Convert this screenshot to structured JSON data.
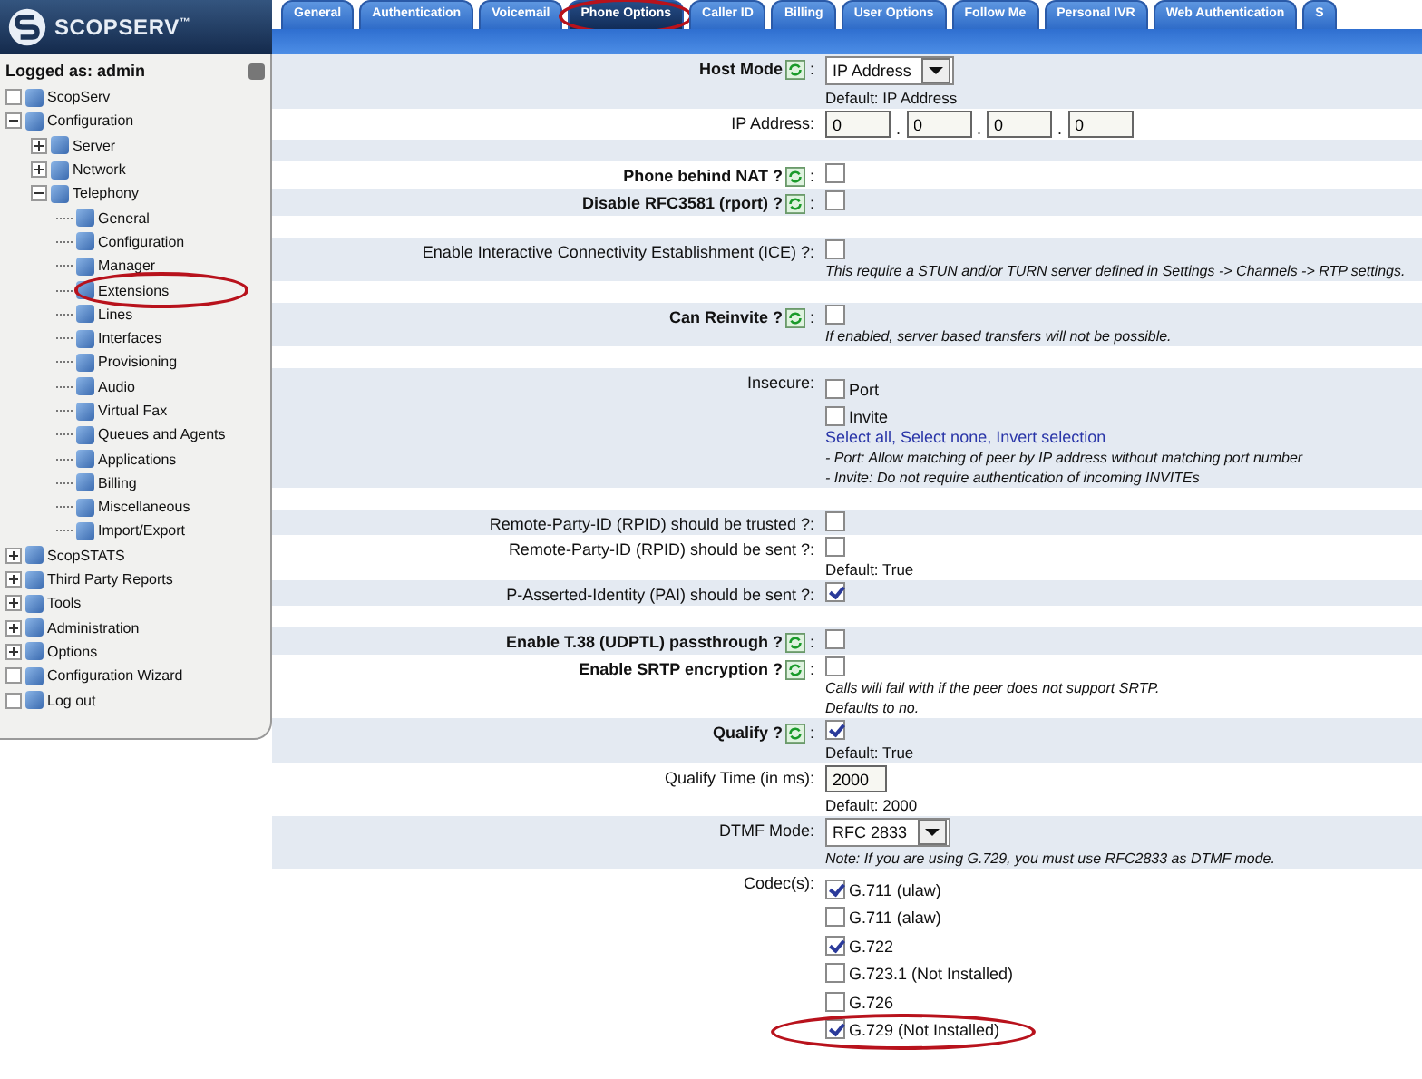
{
  "logo": {
    "name": "SCOPSERV",
    "mark": "™"
  },
  "tabs": [
    {
      "label": "General",
      "selected": false
    },
    {
      "label": "Authentication",
      "selected": false
    },
    {
      "label": "Voicemail",
      "selected": false
    },
    {
      "label": "Phone Options",
      "selected": true,
      "circled": true
    },
    {
      "label": "Caller ID",
      "selected": false
    },
    {
      "label": "Billing",
      "selected": false
    },
    {
      "label": "User Options",
      "selected": false
    },
    {
      "label": "Follow Me",
      "selected": false
    },
    {
      "label": "Personal IVR",
      "selected": false
    },
    {
      "label": "Web Authentication",
      "selected": false
    },
    {
      "label": "S",
      "selected": false
    }
  ],
  "sidebar": {
    "user": "Logged as: admin",
    "items": [
      {
        "label": "ScopServ"
      },
      {
        "label": "Configuration",
        "expanded": true,
        "children": [
          {
            "label": "Server",
            "expanded": false
          },
          {
            "label": "Network",
            "expanded": false
          },
          {
            "label": "Telephony",
            "expanded": true,
            "children": [
              {
                "label": "General"
              },
              {
                "label": "Configuration"
              },
              {
                "label": "Manager"
              },
              {
                "label": "Extensions",
                "circled": true
              },
              {
                "label": "Lines"
              },
              {
                "label": "Interfaces"
              },
              {
                "label": "Provisioning"
              },
              {
                "label": "Audio"
              },
              {
                "label": "Virtual Fax"
              },
              {
                "label": "Queues and Agents"
              },
              {
                "label": "Applications"
              },
              {
                "label": "Billing"
              },
              {
                "label": "Miscellaneous"
              },
              {
                "label": "Import/Export"
              }
            ]
          }
        ]
      },
      {
        "label": "ScopSTATS",
        "expanded": false
      },
      {
        "label": "Third Party Reports",
        "expanded": false
      },
      {
        "label": "Tools",
        "expanded": false
      },
      {
        "label": "Administration",
        "expanded": false
      },
      {
        "label": "Options",
        "expanded": false
      },
      {
        "label": "Configuration Wizard"
      },
      {
        "label": "Log out"
      }
    ]
  },
  "form": [
    {
      "kind": "select",
      "label": "Host Mode",
      "bold": true,
      "help": true,
      "colon": ":",
      "value": "IP Address",
      "notes": [
        {
          "text": "Default: IP Address",
          "italic": false
        }
      ]
    },
    {
      "kind": "ip",
      "label": "IP Address:",
      "bold": false,
      "octets": [
        "0",
        "0",
        "0",
        "0"
      ],
      "separator": "."
    },
    {
      "kind": "spacer"
    },
    {
      "kind": "checkbox",
      "label": "Phone behind NAT ?",
      "bold": true,
      "help": true,
      "colon": ":",
      "checked": false
    },
    {
      "kind": "checkbox",
      "label": "Disable RFC3581 (rport) ?",
      "bold": true,
      "help": true,
      "colon": ":",
      "checked": false
    },
    {
      "kind": "spacer"
    },
    {
      "kind": "checkbox",
      "label": "Enable Interactive Connectivity Establishment (ICE) ?:",
      "bold": false,
      "checked": false,
      "notes": [
        {
          "text": "This require a STUN and/or TURN server defined in Settings -> Channels -> RTP settings.",
          "italic": true
        }
      ]
    },
    {
      "kind": "spacer"
    },
    {
      "kind": "checkbox",
      "label": "Can Reinvite ?",
      "bold": true,
      "help": true,
      "colon": ":",
      "checked": false,
      "notes": [
        {
          "text": "If enabled, server based transfers will not be possible.",
          "italic": true
        }
      ]
    },
    {
      "kind": "spacer"
    },
    {
      "kind": "options",
      "label": "Insecure:",
      "bold": false,
      "options": [
        {
          "label": "Port",
          "checked": false
        },
        {
          "label": "Invite",
          "checked": false
        }
      ],
      "links": [
        "Select all",
        "Select none",
        "Invert selection"
      ],
      "link_separator": ", ",
      "notes": [
        {
          "text": "- Port: Allow matching of peer by IP address without matching port number",
          "italic": true
        },
        {
          "text": "- Invite: Do not require authentication of incoming INVITEs",
          "italic": true
        }
      ]
    },
    {
      "kind": "spacer"
    },
    {
      "kind": "checkbox",
      "label": "Remote-Party-ID (RPID) should be trusted ?:",
      "bold": false,
      "checked": false
    },
    {
      "kind": "checkbox",
      "label": "Remote-Party-ID (RPID) should be sent ?:",
      "bold": false,
      "checked": false,
      "notes": [
        {
          "text": "Default: True",
          "italic": false
        }
      ]
    },
    {
      "kind": "checkbox",
      "label": "P-Asserted-Identity (PAI) should be sent ?:",
      "bold": false,
      "checked": true
    },
    {
      "kind": "spacer"
    },
    {
      "kind": "checkbox",
      "label": "Enable T.38 (UDPTL) passthrough ?",
      "bold": true,
      "help": true,
      "colon": ":",
      "checked": false
    },
    {
      "kind": "checkbox",
      "label": "Enable SRTP encryption ?",
      "bold": true,
      "help": true,
      "colon": ":",
      "checked": false,
      "notes": [
        {
          "text": "Calls will fail with if the peer does not support SRTP.",
          "italic": true
        },
        {
          "text": "Defaults to no.",
          "italic": true
        }
      ]
    },
    {
      "kind": "checkbox",
      "label": "Qualify ?",
      "bold": true,
      "help": true,
      "colon": ":",
      "checked": true,
      "notes": [
        {
          "text": "Default: True",
          "italic": false
        }
      ]
    },
    {
      "kind": "text",
      "label": "Qualify Time (in ms):",
      "bold": false,
      "value": "2000",
      "notes": [
        {
          "text": "Default: 2000",
          "italic": false
        }
      ]
    },
    {
      "kind": "select",
      "label": "DTMF Mode:",
      "bold": false,
      "value": "RFC 2833",
      "notes": [
        {
          "text": "Note: If you are using G.729, you must use RFC2833 as DTMF mode.",
          "italic": true
        }
      ]
    },
    {
      "kind": "options",
      "label": "Codec(s):",
      "bold": false,
      "options": [
        {
          "label": "G.711 (ulaw)",
          "checked": true
        },
        {
          "label": "G.711 (alaw)",
          "checked": false
        },
        {
          "label": "G.722",
          "checked": true
        },
        {
          "label": "G.723.1 (Not Installed)",
          "checked": false
        },
        {
          "label": "G.726",
          "checked": false
        },
        {
          "label": "G.729 (Not Installed)",
          "checked": true,
          "circled": true
        }
      ]
    }
  ]
}
